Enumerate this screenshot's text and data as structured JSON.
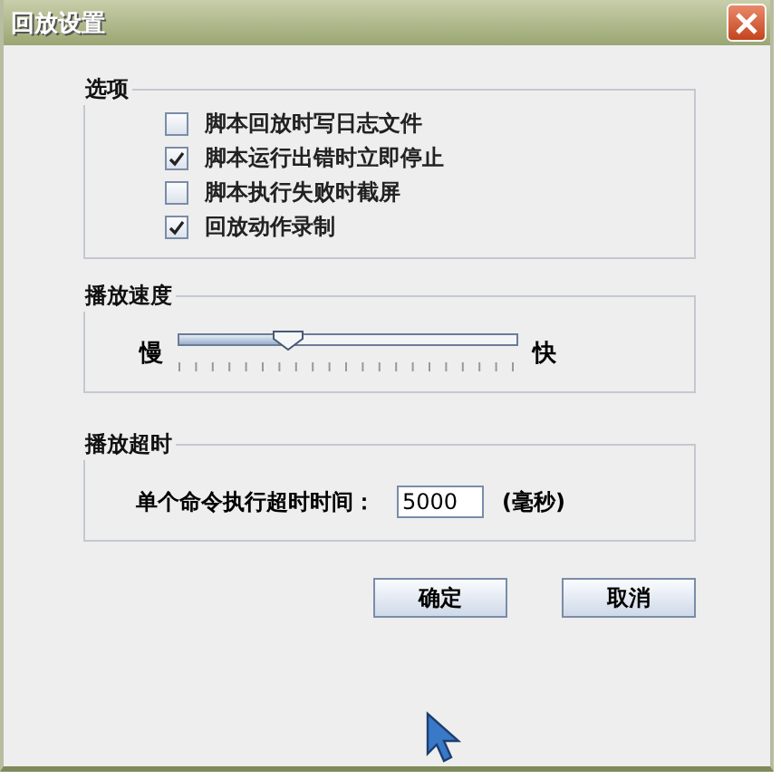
{
  "window": {
    "title": "回放设置"
  },
  "options": {
    "title": "选项",
    "items": [
      {
        "label": "脚本回放时写日志文件",
        "checked": false
      },
      {
        "label": "脚本运行出错时立即停止",
        "checked": true
      },
      {
        "label": "脚本执行失败时截屏",
        "checked": false
      },
      {
        "label": "回放动作录制",
        "checked": true
      }
    ]
  },
  "speed": {
    "title": "播放速度",
    "min_label": "慢",
    "max_label": "快",
    "level": 0.32
  },
  "timeout": {
    "title": "播放超时",
    "label": "单个命令执行超时时间：",
    "value": "5000",
    "unit": "(毫秒)"
  },
  "buttons": [
    "确定",
    "取消"
  ]
}
